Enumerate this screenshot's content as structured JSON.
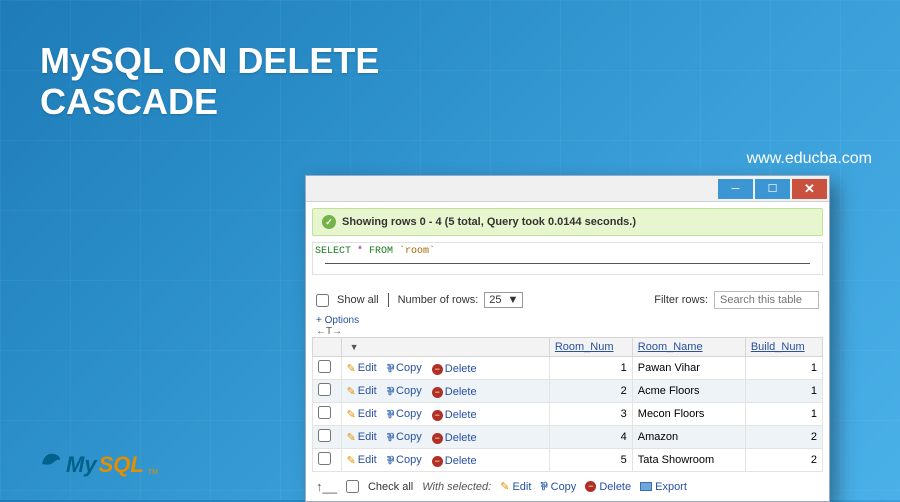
{
  "page": {
    "title_line1": "MySQL ON DELETE",
    "title_line2": "CASCADE",
    "website": "www.educba.com"
  },
  "logo": {
    "my": "My",
    "sql": "SQL",
    "tm": "TM"
  },
  "window": {
    "status_text": "Showing rows 0 - 4 (5 total, Query took 0.0144 seconds.)",
    "query_select": "SELECT",
    "query_star": " * ",
    "query_from": "FROM",
    "query_table": " `room`",
    "toolbar": {
      "show_all_label": "Show all",
      "num_rows_label": "Number of rows:",
      "num_rows_value": "25",
      "filter_label": "Filter rows:",
      "filter_placeholder": "Search this table"
    },
    "options_label": "+ Options",
    "arrows_label": "←T→",
    "columns": {
      "room_num": "Room_Num",
      "room_name": "Room_Name",
      "build_num": "Build_Num"
    },
    "actions": {
      "edit": "Edit",
      "copy": "Copy",
      "delete": "Delete"
    },
    "rows": [
      {
        "room_num": "1",
        "room_name": "Pawan Vihar",
        "build_num": "1"
      },
      {
        "room_num": "2",
        "room_name": "Acme Floors",
        "build_num": "1"
      },
      {
        "room_num": "3",
        "room_name": "Mecon Floors",
        "build_num": "1"
      },
      {
        "room_num": "4",
        "room_name": "Amazon",
        "build_num": "2"
      },
      {
        "room_num": "5",
        "room_name": "Tata Showroom",
        "build_num": "2"
      }
    ],
    "footer": {
      "check_all": "Check all",
      "with_selected": "With selected:",
      "edit": "Edit",
      "copy": "Copy",
      "delete": "Delete",
      "export": "Export"
    }
  }
}
